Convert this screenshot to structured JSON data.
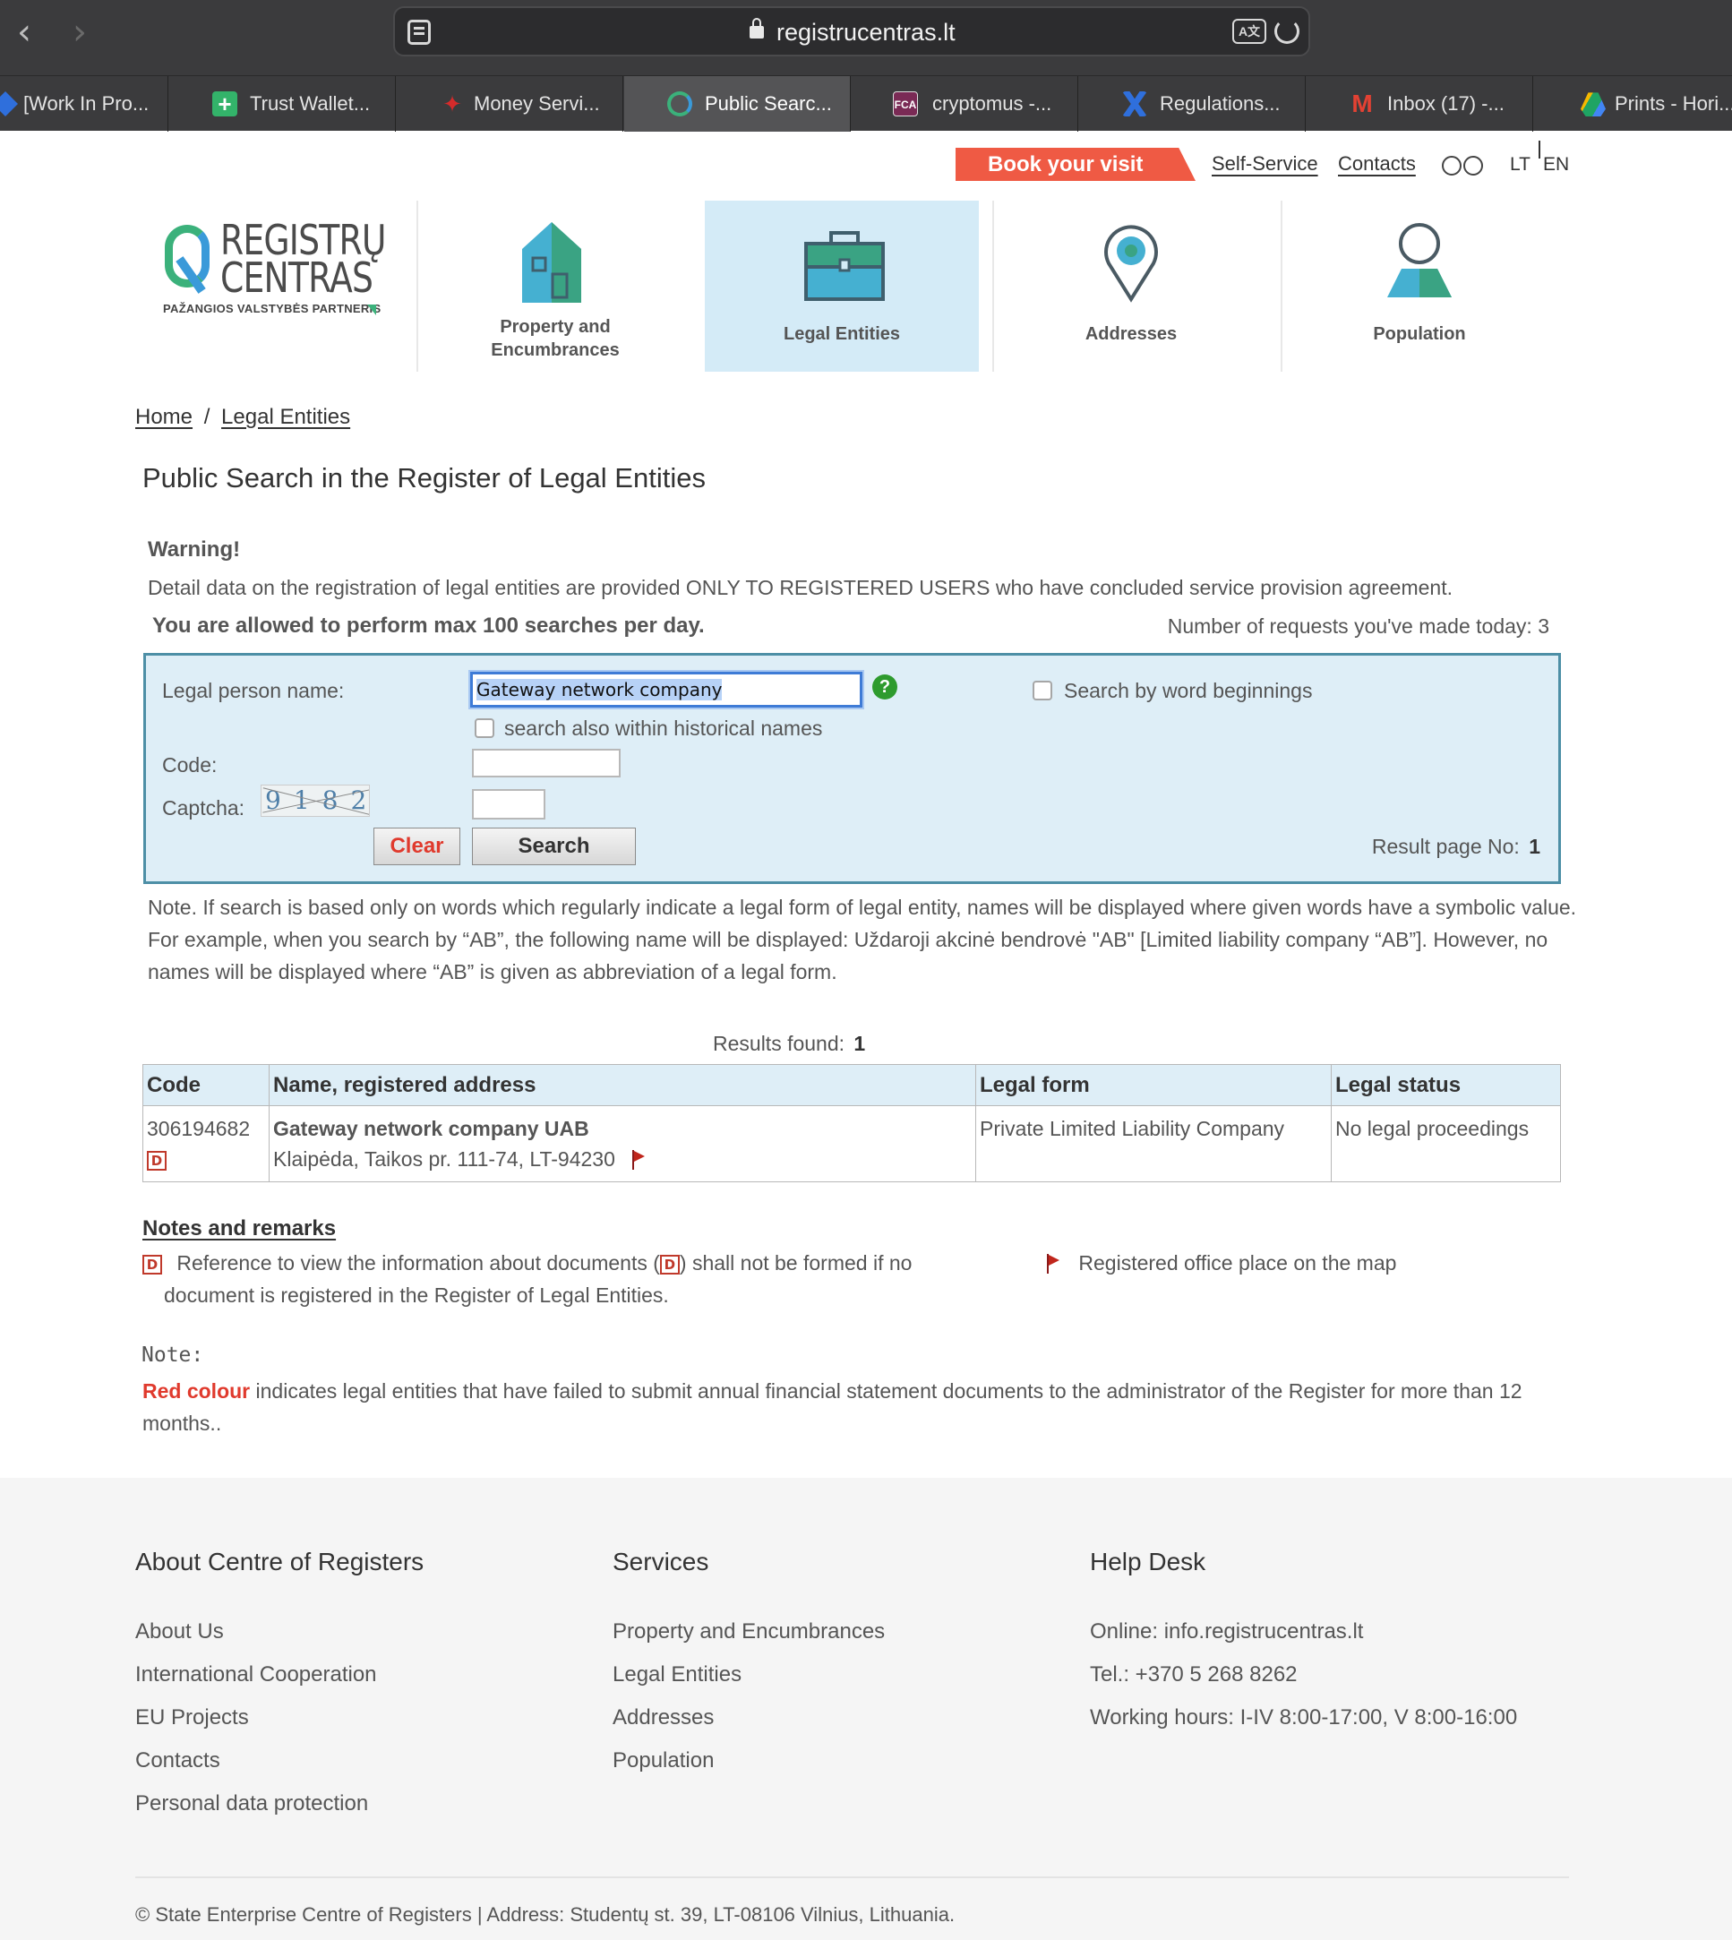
{
  "browser": {
    "url": "registrucentras.lt",
    "tabs": [
      {
        "label": "[Work In Pro...",
        "active": false
      },
      {
        "label": "Trust Wallet...",
        "active": false
      },
      {
        "label": "Money Servi...",
        "active": false
      },
      {
        "label": "Public Searc...",
        "active": true
      },
      {
        "label": "cryptomus -...",
        "active": false
      },
      {
        "label": "Regulations...",
        "active": false
      },
      {
        "label": "Inbox (17) -...",
        "active": false
      },
      {
        "label": "Prints - Hori...",
        "active": false
      }
    ]
  },
  "header": {
    "book_visit": "Book your visit",
    "self_service": "Self-Service",
    "contacts": "Contacts",
    "lang_lt": "LT",
    "lang_en": "EN",
    "logo_line1": "REGISTRŲ",
    "logo_line2": "CENTRAS",
    "logo_tagline": "PAŽANGIOS VALSTYBĖS PARTNERIS"
  },
  "nav": {
    "property_line1": "Property and",
    "property_line2": "Encumbrances",
    "legal": "Legal Entities",
    "addresses": "Addresses",
    "population": "Population"
  },
  "breadcrumb": {
    "home": "Home",
    "sep": "/",
    "current": "Legal Entities"
  },
  "page": {
    "title": "Public Search in the Register of Legal Entities",
    "warning_title": "Warning!",
    "warning_text": "Detail data on the registration of legal entities are provided ONLY TO REGISTERED USERS who have concluded service provision agreement.",
    "limit_text": "You are allowed to perform max 100 searches per day.",
    "requests_text": "Number of requests you've made today: 3"
  },
  "search_form": {
    "name_label": "Legal person name:",
    "name_value": "Gateway network company",
    "help_symbol": "?",
    "word_beginnings_label": "Search by word beginnings",
    "historical_label": "search also within historical names",
    "code_label": "Code:",
    "code_value": "",
    "captcha_label": "Captcha:",
    "captcha_text": "9182",
    "captcha_value": "",
    "clear_label": "Clear",
    "search_label": "Search",
    "result_page_label": "Result page No:",
    "result_page_no": "1"
  },
  "note_text": "Note. If search is based only on words which regularly indicate a legal form of legal entity, names will be displayed where given words have a symbolic value. For example, when you search by “AB”, the following name will be displayed: Uždaroji akcinė bendrovė \"AB\" [Limited liability company “AB”]. However, no names will be displayed where “AB” is given as abbreviation of a legal form.",
  "results": {
    "found_label": "Results found:",
    "found_count": "1",
    "columns": [
      "Code",
      "Name, registered address",
      "Legal form",
      "Legal status"
    ],
    "rows": [
      {
        "code": "306194682",
        "doc_icon": "D",
        "name": "Gateway network company UAB",
        "address": "Klaipėda, Taikos pr. 111-74, LT-94230",
        "legal_form": "Private Limited Liability Company",
        "legal_status": "No legal proceedings"
      }
    ]
  },
  "notes": {
    "title": "Notes and remarks",
    "doc_text_a": "Reference to view the information about documents (",
    "doc_text_b": ") shall not be formed if no",
    "doc_text_c": "document is registered in the Register of Legal Entities.",
    "map_text": "Registered office place on the map",
    "note_label": "Note:",
    "red_label": "Red colour",
    "red_text": " indicates legal entities that have failed to submit annual financial statement documents to the administrator of the Register for more than 12 months.."
  },
  "footer": {
    "about_title": "About Centre of Registers",
    "about_links": [
      "About Us",
      "International Cooperation",
      "EU Projects",
      "Contacts",
      "Personal data protection"
    ],
    "services_title": "Services",
    "services_links": [
      "Property and Encumbrances",
      "Legal Entities",
      "Addresses",
      "Population"
    ],
    "help_title": "Help Desk",
    "help_lines": [
      "Online: info.registrucentras.lt",
      "Tel.: +370 5 268 8262",
      "Working hours: I-IV 8:00-17:00, V 8:00-16:00"
    ],
    "copyright": "© State Enterprise Centre of Registers | Address: Studentų st. 39, LT-08106 Vilnius, Lithuania."
  },
  "colors": {
    "accent_red": "#ef5a44",
    "nav_active_bg": "#d4ebf7",
    "form_border": "#4d8fa6",
    "logo_green": "#3bb17b",
    "logo_blue": "#3a9ad9"
  }
}
